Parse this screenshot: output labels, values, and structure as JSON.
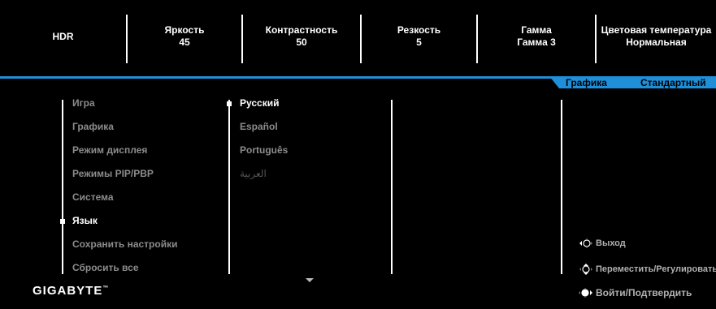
{
  "top_items": [
    {
      "title": "HDR",
      "value": ""
    },
    {
      "title": "Яркость",
      "value": "45"
    },
    {
      "title": "Контрастность",
      "value": "50"
    },
    {
      "title": "Резкость",
      "value": "5"
    },
    {
      "title": "Гамма",
      "value": "Гамма 3"
    },
    {
      "title": "Цветовая температура",
      "value": "Нормальная"
    }
  ],
  "tabs": {
    "mode": "Графика",
    "preset": "Стандартный"
  },
  "menu": [
    "Игра",
    "Графика",
    "Режим дисплея",
    "Режимы PIP/PBP",
    "Система",
    "Язык",
    "Сохранить настройки",
    "Сбросить все"
  ],
  "menu_active": "Язык",
  "languages": [
    "Русский",
    "Español",
    "Português",
    "العربية"
  ],
  "language_selected": "Русский",
  "hints": {
    "exit": "Выход",
    "move": "Переместить/Регулировать",
    "enter": "Войти/Подтвердить"
  },
  "brand": "GIGABYTE",
  "trademark": "™",
  "colors": {
    "accent": "#1e8fd8",
    "background": "#000000",
    "inactive_text": "#8c8c8c"
  }
}
